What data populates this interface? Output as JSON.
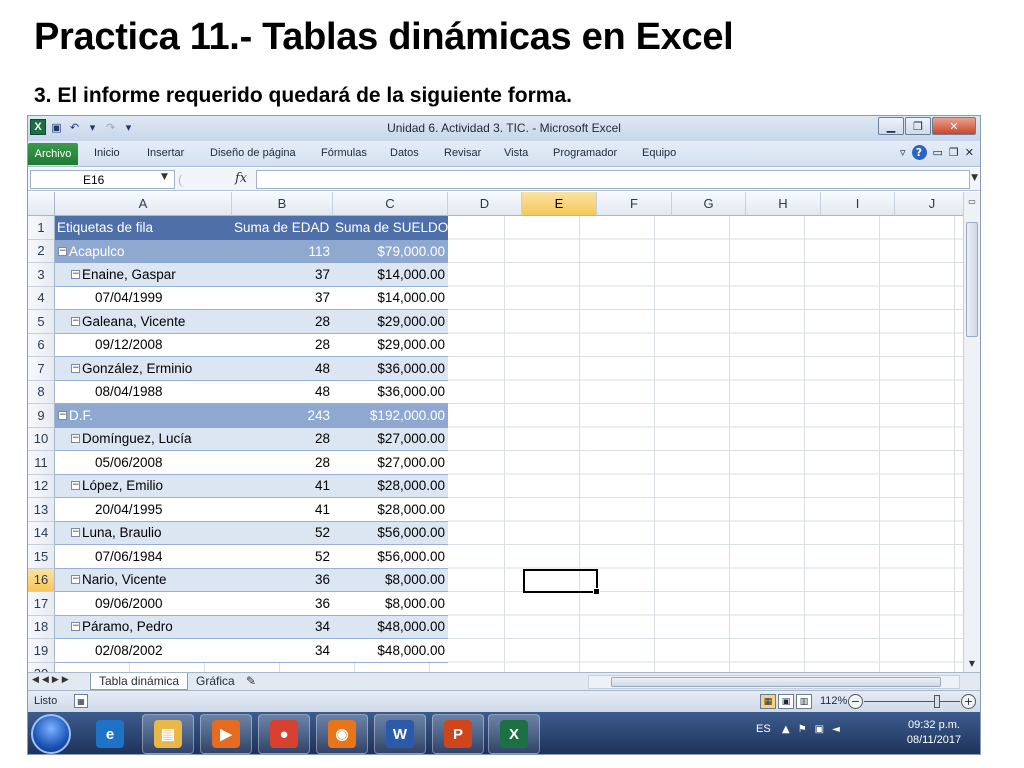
{
  "slide": {
    "title": "Practica 11.- Tablas dinámicas en Excel",
    "subtitle": "3. El informe requerido quedará de la siguiente forma."
  },
  "window": {
    "title": "Unidad 6. Actividad 3. TIC. - Microsoft Excel",
    "app_icon": "X"
  },
  "ribbon": {
    "tabs": [
      "Archivo",
      "Inicio",
      "Insertar",
      "Diseño de página",
      "Fórmulas",
      "Datos",
      "Revisar",
      "Vista",
      "Programador",
      "Equipo"
    ]
  },
  "formula_bar": {
    "name_box": "E16",
    "fx": "fx",
    "value": ""
  },
  "columns": [
    "A",
    "B",
    "C",
    "D",
    "E",
    "F",
    "G",
    "H",
    "I",
    "J"
  ],
  "selected_column": "E",
  "selected_row": "16",
  "rows": [
    "1",
    "2",
    "3",
    "4",
    "5",
    "6",
    "7",
    "8",
    "9",
    "10",
    "11",
    "12",
    "13",
    "14",
    "15",
    "16",
    "17",
    "18",
    "19",
    "20"
  ],
  "pivot": {
    "header": [
      "Etiquetas de fila",
      "Suma de EDAD",
      "Suma de SUELDO"
    ],
    "rows": [
      {
        "level": "city",
        "label": "Acapulco",
        "edad": "113",
        "sueldo": "$79,000.00"
      },
      {
        "level": "person",
        "label": "Enaine, Gaspar",
        "edad": "37",
        "sueldo": "$14,000.00"
      },
      {
        "level": "date",
        "label": "07/04/1999",
        "edad": "37",
        "sueldo": "$14,000.00"
      },
      {
        "level": "person",
        "label": "Galeana, Vicente",
        "edad": "28",
        "sueldo": "$29,000.00"
      },
      {
        "level": "date",
        "label": "09/12/2008",
        "edad": "28",
        "sueldo": "$29,000.00"
      },
      {
        "level": "person",
        "label": "González, Erminio",
        "edad": "48",
        "sueldo": "$36,000.00"
      },
      {
        "level": "date",
        "label": "08/04/1988",
        "edad": "48",
        "sueldo": "$36,000.00"
      },
      {
        "level": "city",
        "label": "D.F.",
        "edad": "243",
        "sueldo": "$192,000.00"
      },
      {
        "level": "person",
        "label": "Domínguez, Lucía",
        "edad": "28",
        "sueldo": "$27,000.00"
      },
      {
        "level": "date",
        "label": "05/06/2008",
        "edad": "28",
        "sueldo": "$27,000.00"
      },
      {
        "level": "person",
        "label": "López, Emilio",
        "edad": "41",
        "sueldo": "$28,000.00"
      },
      {
        "level": "date",
        "label": "20/04/1995",
        "edad": "41",
        "sueldo": "$28,000.00"
      },
      {
        "level": "person",
        "label": "Luna, Braulio",
        "edad": "52",
        "sueldo": "$56,000.00"
      },
      {
        "level": "date",
        "label": "07/06/1984",
        "edad": "52",
        "sueldo": "$56,000.00"
      },
      {
        "level": "person",
        "label": "Nario, Vicente",
        "edad": "36",
        "sueldo": "$8,000.00"
      },
      {
        "level": "date",
        "label": "09/06/2000",
        "edad": "36",
        "sueldo": "$8,000.00"
      },
      {
        "level": "person",
        "label": "Páramo, Pedro",
        "edad": "34",
        "sueldo": "$48,000.00"
      },
      {
        "level": "date",
        "label": "02/08/2002",
        "edad": "34",
        "sueldo": "$48,000.00"
      }
    ]
  },
  "sheets": {
    "active": "Tabla dinámica",
    "other": "Gráfica"
  },
  "status": {
    "mode": "Listo",
    "zoom": "112%"
  },
  "taskbar": {
    "apps": [
      {
        "name": "internet-explorer",
        "glyph": "e",
        "color": "#1e73c9"
      },
      {
        "name": "file-explorer",
        "glyph": "▤",
        "color": "#e8b84a"
      },
      {
        "name": "media-player",
        "glyph": "▶",
        "color": "#e46b1f"
      },
      {
        "name": "chrome",
        "glyph": "●",
        "color": "#d8402f"
      },
      {
        "name": "firefox",
        "glyph": "◉",
        "color": "#e8751a"
      },
      {
        "name": "word",
        "glyph": "W",
        "color": "#2b5aa8"
      },
      {
        "name": "powerpoint",
        "glyph": "P",
        "color": "#d0451b"
      },
      {
        "name": "excel",
        "glyph": "X",
        "color": "#1d7044"
      }
    ],
    "lang": "ES",
    "time": "09:32 p.m.",
    "date": "08/11/2017"
  },
  "colors": {
    "pivot_header": "#4f6fa8",
    "pivot_city": "#8ea8cf",
    "pivot_person": "#dce6f2",
    "selection_header": "#f5c75b"
  }
}
